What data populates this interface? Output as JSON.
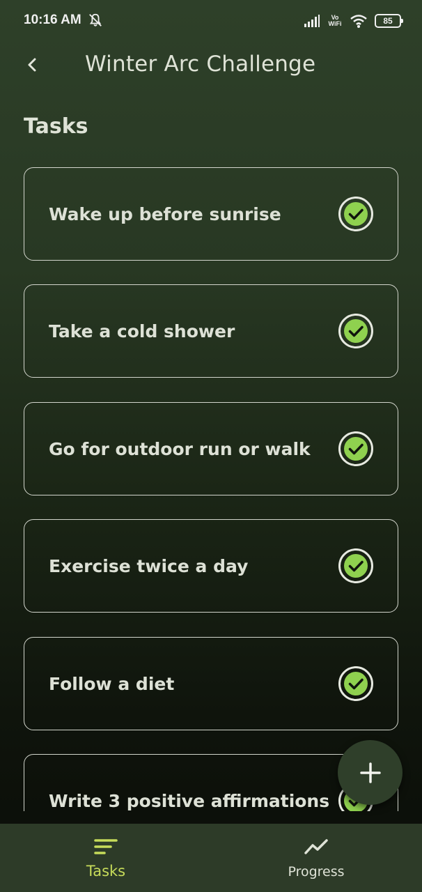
{
  "status_bar": {
    "time": "10:16 AM",
    "vowifi_top": "Vo",
    "vowifi_bottom": "WiFi",
    "battery": "85"
  },
  "header": {
    "title": "Winter Arc Challenge"
  },
  "section": {
    "title": "Tasks"
  },
  "tasks": [
    {
      "label": "Wake up before sunrise",
      "completed": true
    },
    {
      "label": "Take a cold shower",
      "completed": true
    },
    {
      "label": "Go for outdoor run or walk",
      "completed": true
    },
    {
      "label": "Exercise twice a day",
      "completed": true
    },
    {
      "label": "Follow a diet",
      "completed": true
    },
    {
      "label": "Write 3 positive affirmations",
      "completed": true
    }
  ],
  "fab": {
    "icon": "plus-icon"
  },
  "bottom_nav": {
    "tasks_label": "Tasks",
    "progress_label": "Progress",
    "active": "Tasks"
  },
  "colors": {
    "accent": "#c7dc5a",
    "check_fill": "#8fd14f",
    "nav_background": "#2d3b28",
    "card_border": "#d3d6cd"
  }
}
